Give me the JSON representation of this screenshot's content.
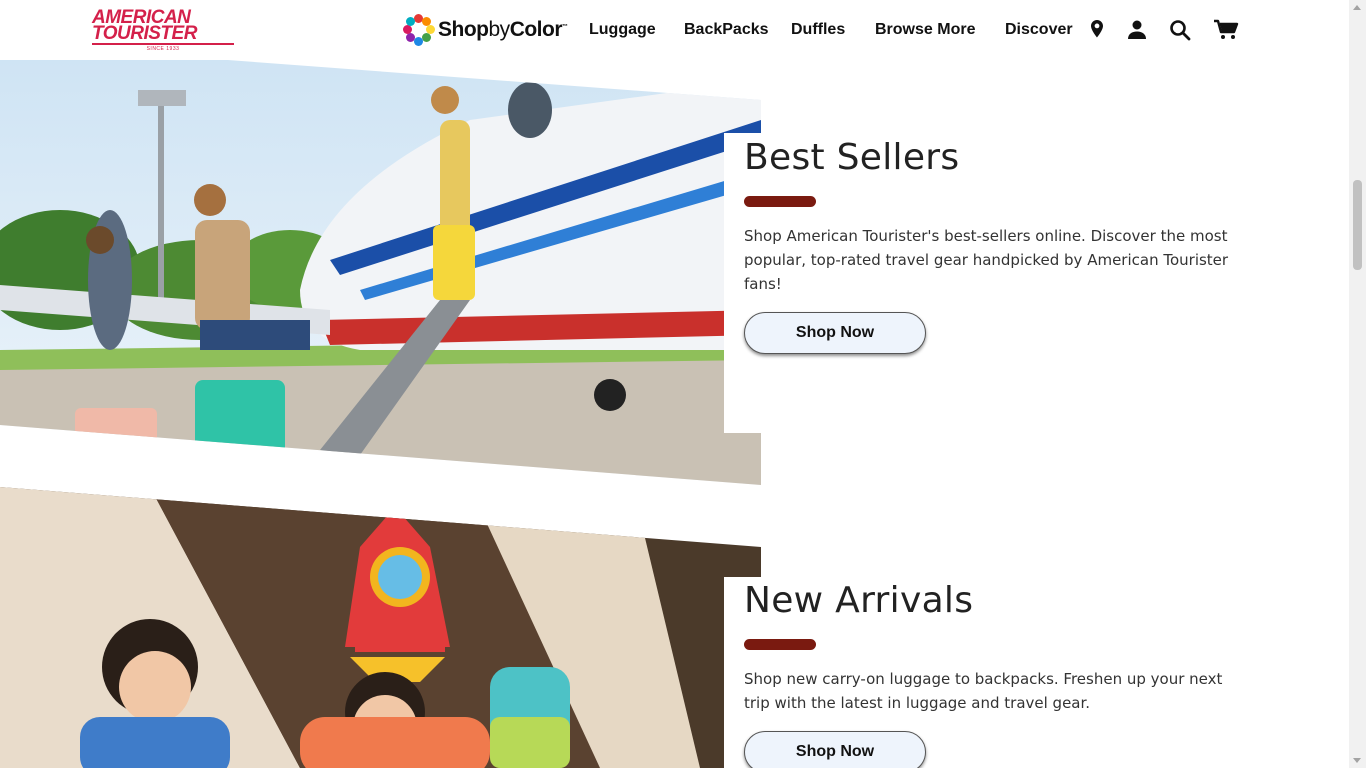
{
  "brand": {
    "logo_line1": "AMERICAN",
    "logo_line2": "TOURISTER",
    "logo_since": "SINCE 1933",
    "color": "#d4204a"
  },
  "shop_by_color": {
    "bold1": "Shop",
    "light": "by",
    "bold2": "Color",
    "tm": "™",
    "dot_colors": [
      "#e53935",
      "#fb8c00",
      "#fdd835",
      "#43a047",
      "#1e88e5",
      "#8e24aa",
      "#d81b60",
      "#00acc1"
    ]
  },
  "nav": {
    "items": [
      "Luggage",
      "BackPacks",
      "Duffles",
      "Browse More",
      "Discover"
    ]
  },
  "header_icons": [
    "location-pin-icon",
    "account-icon",
    "search-icon",
    "cart-icon"
  ],
  "sections": [
    {
      "title": "Best Sellers",
      "description": "Shop American Tourister's best-sellers online. Discover the most popular, top-rated travel gear handpicked by American Tourister fans!",
      "button": "Shop Now"
    },
    {
      "title": "New Arrivals",
      "description": "Shop new carry-on luggage to backpacks. Freshen up your next trip with the latest in luggage and travel gear.",
      "button": "Shop Now"
    }
  ],
  "colors": {
    "accent_bar": "#7a1a10",
    "button_bg": "#eef4fc"
  }
}
